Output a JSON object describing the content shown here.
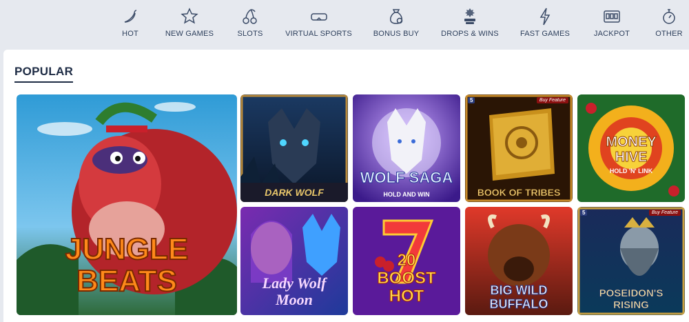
{
  "nav": {
    "items": [
      {
        "label": "HOT",
        "icon": "chili-pepper-icon"
      },
      {
        "label": "NEW GAMES",
        "icon": "star-icon"
      },
      {
        "label": "SLOTS",
        "icon": "cherries-icon"
      },
      {
        "label": "VIRTUAL SPORTS",
        "icon": "vr-goggles-icon"
      },
      {
        "label": "BONUS BUY",
        "icon": "money-bag-icon"
      },
      {
        "label": "DROPS & WINS",
        "icon": "drops-wins-icon"
      },
      {
        "label": "FAST GAMES",
        "icon": "lightning-icon"
      },
      {
        "label": "JACKPOT",
        "icon": "slot-machine-icon"
      },
      {
        "label": "OTHER",
        "icon": "stopwatch-icon"
      }
    ]
  },
  "section": {
    "title": "POPULAR"
  },
  "games": [
    {
      "title": "JUNGLE BEATS"
    },
    {
      "title": "DARK WOLF"
    },
    {
      "title": "WOLF SAGA",
      "subtitle": "HOLD AND WIN"
    },
    {
      "title": "BOOK OF TRIBES",
      "badge": "Buy Feature",
      "provider": "5"
    },
    {
      "title": "MONEY HIVE",
      "subtitle": "HOLD 'N' LINK"
    },
    {
      "title": "Lady Wolf Moon"
    },
    {
      "title": "20 BOOST HOT"
    },
    {
      "title": "BIG WILD BUFFALO"
    },
    {
      "title": "POSEIDON'S RISING",
      "badge": "Buy Feature",
      "provider": "5"
    }
  ],
  "colors": {
    "nav_bg": "#e6e9ef",
    "text": "#2c3e5b",
    "panel": "#ffffff"
  }
}
